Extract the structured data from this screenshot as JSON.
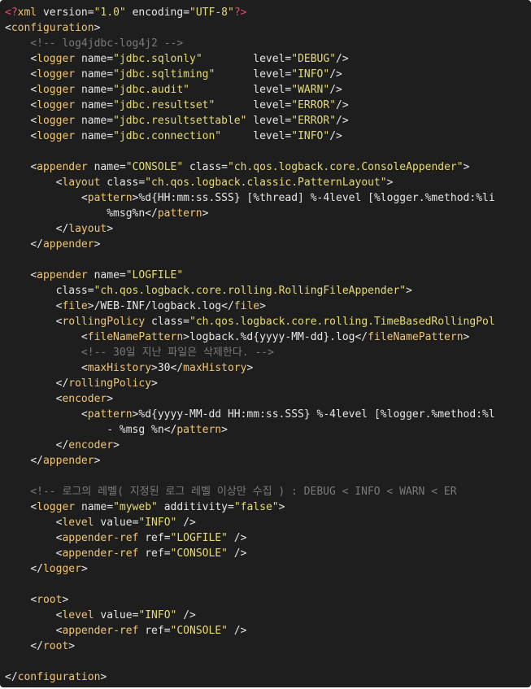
{
  "colors": {
    "background": "#1e1e1e",
    "tag": "#f0c674",
    "processing_instruction": "#e84b6b",
    "string": "#e6db74",
    "comment": "#7a7a7a",
    "text": "#e6e6e6"
  },
  "code_lines": [
    [
      [
        "pi",
        "<?"
      ],
      [
        "tag",
        "xml"
      ],
      [
        "text",
        " "
      ],
      [
        "attr",
        "version"
      ],
      [
        "punc",
        "="
      ],
      [
        "val",
        "\"1.0\""
      ],
      [
        "text",
        " "
      ],
      [
        "attr",
        "encoding"
      ],
      [
        "punc",
        "="
      ],
      [
        "val",
        "\"UTF-8\""
      ],
      [
        "pi",
        "?>"
      ]
    ],
    [
      [
        "punc",
        "<"
      ],
      [
        "tag",
        "configuration"
      ],
      [
        "punc",
        ">"
      ]
    ],
    [
      [
        "cmt",
        "    <!-- log4jdbc-log4j2 -->"
      ]
    ],
    [
      [
        "text",
        "    "
      ],
      [
        "punc",
        "<"
      ],
      [
        "tag",
        "logger"
      ],
      [
        "text",
        " "
      ],
      [
        "attr",
        "name"
      ],
      [
        "punc",
        "="
      ],
      [
        "val",
        "\"jdbc.sqlonly\""
      ],
      [
        "text",
        "        "
      ],
      [
        "attr",
        "level"
      ],
      [
        "punc",
        "="
      ],
      [
        "val",
        "\"DEBUG\""
      ],
      [
        "punc",
        "/>"
      ]
    ],
    [
      [
        "text",
        "    "
      ],
      [
        "punc",
        "<"
      ],
      [
        "tag",
        "logger"
      ],
      [
        "text",
        " "
      ],
      [
        "attr",
        "name"
      ],
      [
        "punc",
        "="
      ],
      [
        "val",
        "\"jdbc.sqltiming\""
      ],
      [
        "text",
        "      "
      ],
      [
        "attr",
        "level"
      ],
      [
        "punc",
        "="
      ],
      [
        "val",
        "\"INFO\""
      ],
      [
        "punc",
        "/>"
      ]
    ],
    [
      [
        "text",
        "    "
      ],
      [
        "punc",
        "<"
      ],
      [
        "tag",
        "logger"
      ],
      [
        "text",
        " "
      ],
      [
        "attr",
        "name"
      ],
      [
        "punc",
        "="
      ],
      [
        "val",
        "\"jdbc.audit\""
      ],
      [
        "text",
        "          "
      ],
      [
        "attr",
        "level"
      ],
      [
        "punc",
        "="
      ],
      [
        "val",
        "\"WARN\""
      ],
      [
        "punc",
        "/>"
      ]
    ],
    [
      [
        "text",
        "    "
      ],
      [
        "punc",
        "<"
      ],
      [
        "tag",
        "logger"
      ],
      [
        "text",
        " "
      ],
      [
        "attr",
        "name"
      ],
      [
        "punc",
        "="
      ],
      [
        "val",
        "\"jdbc.resultset\""
      ],
      [
        "text",
        "      "
      ],
      [
        "attr",
        "level"
      ],
      [
        "punc",
        "="
      ],
      [
        "val",
        "\"ERROR\""
      ],
      [
        "punc",
        "/>"
      ]
    ],
    [
      [
        "text",
        "    "
      ],
      [
        "punc",
        "<"
      ],
      [
        "tag",
        "logger"
      ],
      [
        "text",
        " "
      ],
      [
        "attr",
        "name"
      ],
      [
        "punc",
        "="
      ],
      [
        "val",
        "\"jdbc.resultsettable\""
      ],
      [
        "text",
        " "
      ],
      [
        "attr",
        "level"
      ],
      [
        "punc",
        "="
      ],
      [
        "val",
        "\"ERROR\""
      ],
      [
        "punc",
        "/>"
      ]
    ],
    [
      [
        "text",
        "    "
      ],
      [
        "punc",
        "<"
      ],
      [
        "tag",
        "logger"
      ],
      [
        "text",
        " "
      ],
      [
        "attr",
        "name"
      ],
      [
        "punc",
        "="
      ],
      [
        "val",
        "\"jdbc.connection\""
      ],
      [
        "text",
        "     "
      ],
      [
        "attr",
        "level"
      ],
      [
        "punc",
        "="
      ],
      [
        "val",
        "\"INFO\""
      ],
      [
        "punc",
        "/>"
      ]
    ],
    [
      [
        "text",
        ""
      ]
    ],
    [
      [
        "text",
        "    "
      ],
      [
        "punc",
        "<"
      ],
      [
        "tag",
        "appender"
      ],
      [
        "text",
        " "
      ],
      [
        "attr",
        "name"
      ],
      [
        "punc",
        "="
      ],
      [
        "val",
        "\"CONSOLE\""
      ],
      [
        "text",
        " "
      ],
      [
        "attr",
        "class"
      ],
      [
        "punc",
        "="
      ],
      [
        "val",
        "\"ch.qos.logback.core.ConsoleAppender\""
      ],
      [
        "punc",
        ">"
      ]
    ],
    [
      [
        "text",
        "        "
      ],
      [
        "punc",
        "<"
      ],
      [
        "tag",
        "layout"
      ],
      [
        "text",
        " "
      ],
      [
        "attr",
        "class"
      ],
      [
        "punc",
        "="
      ],
      [
        "val",
        "\"ch.qos.logback.classic.PatternLayout\""
      ],
      [
        "punc",
        ">"
      ]
    ],
    [
      [
        "text",
        "            "
      ],
      [
        "punc",
        "<"
      ],
      [
        "tag",
        "pattern"
      ],
      [
        "punc",
        ">"
      ],
      [
        "text",
        "%d{HH:mm:ss.SSS} [%thread] %-4level [%logger.%method:%li"
      ]
    ],
    [
      [
        "text",
        "                %msg%n"
      ],
      [
        "punc",
        "</"
      ],
      [
        "tag",
        "pattern"
      ],
      [
        "punc",
        ">"
      ]
    ],
    [
      [
        "text",
        "        "
      ],
      [
        "punc",
        "</"
      ],
      [
        "tag",
        "layout"
      ],
      [
        "punc",
        ">"
      ]
    ],
    [
      [
        "text",
        "    "
      ],
      [
        "punc",
        "</"
      ],
      [
        "tag",
        "appender"
      ],
      [
        "punc",
        ">"
      ]
    ],
    [
      [
        "text",
        ""
      ]
    ],
    [
      [
        "text",
        "    "
      ],
      [
        "punc",
        "<"
      ],
      [
        "tag",
        "appender"
      ],
      [
        "text",
        " "
      ],
      [
        "attr",
        "name"
      ],
      [
        "punc",
        "="
      ],
      [
        "val",
        "\"LOGFILE\""
      ]
    ],
    [
      [
        "text",
        "        "
      ],
      [
        "attr",
        "class"
      ],
      [
        "punc",
        "="
      ],
      [
        "val",
        "\"ch.qos.logback.core.rolling.RollingFileAppender\""
      ],
      [
        "punc",
        ">"
      ]
    ],
    [
      [
        "text",
        "        "
      ],
      [
        "punc",
        "<"
      ],
      [
        "tag",
        "file"
      ],
      [
        "punc",
        ">"
      ],
      [
        "text",
        "/WEB-INF/logback.log"
      ],
      [
        "punc",
        "</"
      ],
      [
        "tag",
        "file"
      ],
      [
        "punc",
        ">"
      ]
    ],
    [
      [
        "text",
        "        "
      ],
      [
        "punc",
        "<"
      ],
      [
        "tag",
        "rollingPolicy"
      ],
      [
        "text",
        " "
      ],
      [
        "attr",
        "class"
      ],
      [
        "punc",
        "="
      ],
      [
        "val",
        "\"ch.qos.logback.core.rolling.TimeBasedRollingPol"
      ]
    ],
    [
      [
        "text",
        "            "
      ],
      [
        "punc",
        "<"
      ],
      [
        "tag",
        "fileNamePattern"
      ],
      [
        "punc",
        ">"
      ],
      [
        "text",
        "logback.%d{yyyy-MM-dd}.log"
      ],
      [
        "punc",
        "</"
      ],
      [
        "tag",
        "fileNamePattern"
      ],
      [
        "punc",
        ">"
      ]
    ],
    [
      [
        "cmt",
        "            <!-- 30일 지난 파일은 삭제한다. -->"
      ]
    ],
    [
      [
        "text",
        "            "
      ],
      [
        "punc",
        "<"
      ],
      [
        "tag",
        "maxHistory"
      ],
      [
        "punc",
        ">"
      ],
      [
        "text",
        "30"
      ],
      [
        "punc",
        "</"
      ],
      [
        "tag",
        "maxHistory"
      ],
      [
        "punc",
        ">"
      ]
    ],
    [
      [
        "text",
        "        "
      ],
      [
        "punc",
        "</"
      ],
      [
        "tag",
        "rollingPolicy"
      ],
      [
        "punc",
        ">"
      ]
    ],
    [
      [
        "text",
        "        "
      ],
      [
        "punc",
        "<"
      ],
      [
        "tag",
        "encoder"
      ],
      [
        "punc",
        ">"
      ]
    ],
    [
      [
        "text",
        "            "
      ],
      [
        "punc",
        "<"
      ],
      [
        "tag",
        "pattern"
      ],
      [
        "punc",
        ">"
      ],
      [
        "text",
        "%d{yyyy-MM-dd HH:mm:ss.SSS} %-4level [%logger.%method:%l"
      ]
    ],
    [
      [
        "text",
        "                - %msg %n"
      ],
      [
        "punc",
        "</"
      ],
      [
        "tag",
        "pattern"
      ],
      [
        "punc",
        ">"
      ]
    ],
    [
      [
        "text",
        "        "
      ],
      [
        "punc",
        "</"
      ],
      [
        "tag",
        "encoder"
      ],
      [
        "punc",
        ">"
      ]
    ],
    [
      [
        "text",
        "    "
      ],
      [
        "punc",
        "</"
      ],
      [
        "tag",
        "appender"
      ],
      [
        "punc",
        ">"
      ]
    ],
    [
      [
        "text",
        ""
      ]
    ],
    [
      [
        "cmt",
        "    <!-- 로그의 레벨( 지정된 로그 레벨 이상만 수집 ) : DEBUG < INFO < WARN < ER"
      ]
    ],
    [
      [
        "text",
        "    "
      ],
      [
        "punc",
        "<"
      ],
      [
        "tag",
        "logger"
      ],
      [
        "text",
        " "
      ],
      [
        "attr",
        "name"
      ],
      [
        "punc",
        "="
      ],
      [
        "val",
        "\"myweb\""
      ],
      [
        "text",
        " "
      ],
      [
        "attr",
        "additivity"
      ],
      [
        "punc",
        "="
      ],
      [
        "val",
        "\"false\""
      ],
      [
        "punc",
        ">"
      ]
    ],
    [
      [
        "text",
        "        "
      ],
      [
        "punc",
        "<"
      ],
      [
        "tag",
        "level"
      ],
      [
        "text",
        " "
      ],
      [
        "attr",
        "value"
      ],
      [
        "punc",
        "="
      ],
      [
        "val",
        "\"INFO\""
      ],
      [
        "text",
        " "
      ],
      [
        "punc",
        "/>"
      ]
    ],
    [
      [
        "text",
        "        "
      ],
      [
        "punc",
        "<"
      ],
      [
        "tag",
        "appender-ref"
      ],
      [
        "text",
        " "
      ],
      [
        "attr",
        "ref"
      ],
      [
        "punc",
        "="
      ],
      [
        "val",
        "\"LOGFILE\""
      ],
      [
        "text",
        " "
      ],
      [
        "punc",
        "/>"
      ]
    ],
    [
      [
        "text",
        "        "
      ],
      [
        "punc",
        "<"
      ],
      [
        "tag",
        "appender-ref"
      ],
      [
        "text",
        " "
      ],
      [
        "attr",
        "ref"
      ],
      [
        "punc",
        "="
      ],
      [
        "val",
        "\"CONSOLE\""
      ],
      [
        "text",
        " "
      ],
      [
        "punc",
        "/>"
      ]
    ],
    [
      [
        "text",
        "    "
      ],
      [
        "punc",
        "</"
      ],
      [
        "tag",
        "logger"
      ],
      [
        "punc",
        ">"
      ]
    ],
    [
      [
        "text",
        ""
      ]
    ],
    [
      [
        "text",
        "    "
      ],
      [
        "punc",
        "<"
      ],
      [
        "tag",
        "root"
      ],
      [
        "punc",
        ">"
      ]
    ],
    [
      [
        "text",
        "        "
      ],
      [
        "punc",
        "<"
      ],
      [
        "tag",
        "level"
      ],
      [
        "text",
        " "
      ],
      [
        "attr",
        "value"
      ],
      [
        "punc",
        "="
      ],
      [
        "val",
        "\"INFO\""
      ],
      [
        "text",
        " "
      ],
      [
        "punc",
        "/>"
      ]
    ],
    [
      [
        "text",
        "        "
      ],
      [
        "punc",
        "<"
      ],
      [
        "tag",
        "appender-ref"
      ],
      [
        "text",
        " "
      ],
      [
        "attr",
        "ref"
      ],
      [
        "punc",
        "="
      ],
      [
        "val",
        "\"CONSOLE\""
      ],
      [
        "text",
        " "
      ],
      [
        "punc",
        "/>"
      ]
    ],
    [
      [
        "text",
        "    "
      ],
      [
        "punc",
        "</"
      ],
      [
        "tag",
        "root"
      ],
      [
        "punc",
        ">"
      ]
    ],
    [
      [
        "text",
        ""
      ]
    ],
    [
      [
        "punc",
        "</"
      ],
      [
        "tag",
        "configuration"
      ],
      [
        "punc",
        ">"
      ]
    ]
  ]
}
